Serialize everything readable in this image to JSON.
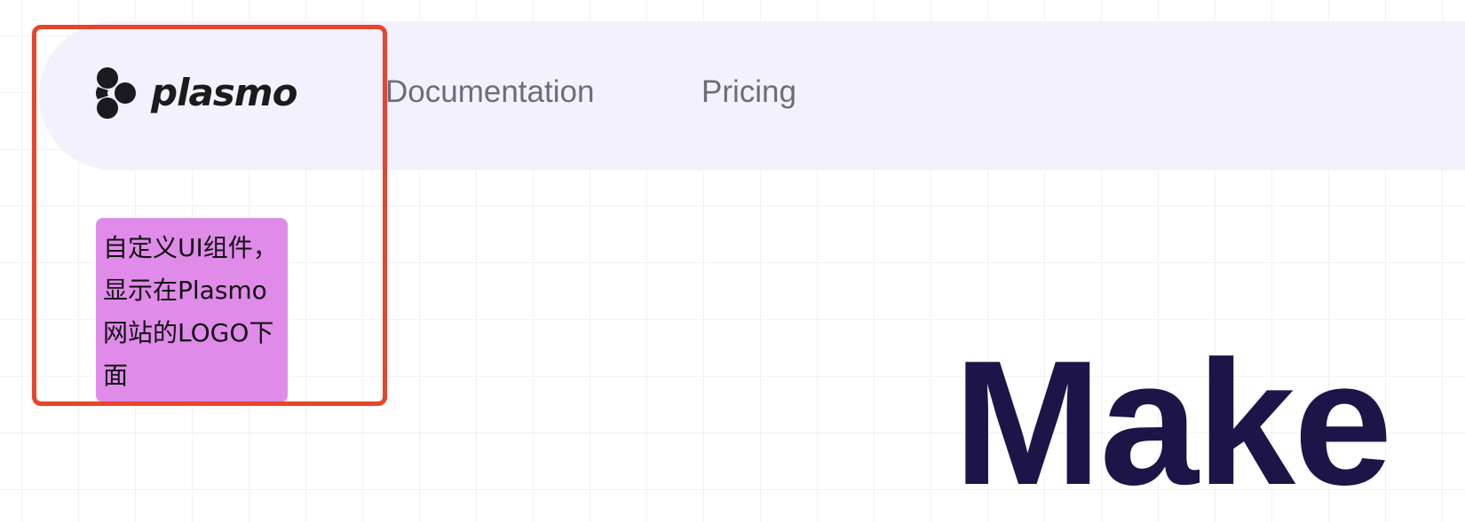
{
  "navbar": {
    "logo": {
      "icon": "plasmo-logo-icon",
      "text": "plasmo"
    },
    "links": [
      {
        "label": "Documentation"
      },
      {
        "label": "Pricing"
      }
    ],
    "background_color": "#f3f1fe"
  },
  "custom_widget": {
    "text": "自定义UI组件，显示在Plasmo网站的LOGO下面",
    "background_color": "#e08be9"
  },
  "annotation": {
    "border_color": "#e8452c"
  },
  "hero": {
    "title": "Make",
    "color": "#1d1547"
  }
}
